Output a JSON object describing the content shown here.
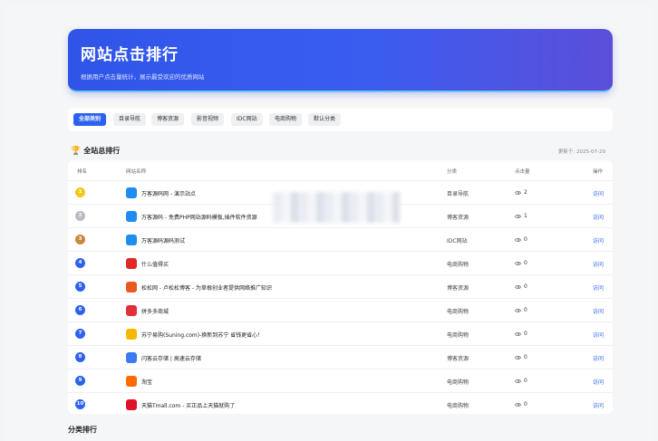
{
  "hero": {
    "title": "网站点击排行",
    "subtitle": "根据用户点击量统计，展示最受欢迎的优质网站"
  },
  "filters": [
    "全部类别",
    "目录导航",
    "博客资源",
    "影音视频",
    "IDC网站",
    "电商购物",
    "默认分类"
  ],
  "overall": {
    "title": "全站总排行",
    "updated": "更新于: 2025-07-29",
    "columns": [
      "排名",
      "网站名称",
      "分类",
      "点击量",
      "操作"
    ],
    "rows": [
      {
        "rank": "1",
        "name": "万客源码网 - 演示站点",
        "category": "目录导航",
        "clicks": "2",
        "action": "访问"
      },
      {
        "rank": "2",
        "name": "万客源码 - 免费PHP网站源码模板,插件软件资源",
        "category": "博客资源",
        "clicks": "1",
        "action": "访问"
      },
      {
        "rank": "3",
        "name": "万客源码源码测试",
        "category": "IDC网站",
        "clicks": "0",
        "action": "访问"
      },
      {
        "rank": "4",
        "name": "什么值得买",
        "category": "电商购物",
        "clicks": "0",
        "action": "访问"
      },
      {
        "rank": "5",
        "name": "松松网 - 卢松松博客 - 为草根创业者提供网络推广知识",
        "category": "博客资源",
        "clicks": "0",
        "action": "访问"
      },
      {
        "rank": "6",
        "name": "拼多多商城",
        "category": "电商购物",
        "clicks": "0",
        "action": "访问"
      },
      {
        "rank": "7",
        "name": "苏宁易购(Suning.com)-换新到苏宁 省钱更省心！",
        "category": "电商购物",
        "clicks": "0",
        "action": "访问"
      },
      {
        "rank": "8",
        "name": "闪客云存储 | 高速云存储",
        "category": "博客资源",
        "clicks": "0",
        "action": "访问"
      },
      {
        "rank": "9",
        "name": "淘宝",
        "category": "电商购物",
        "clicks": "0",
        "action": "访问"
      },
      {
        "rank": "10",
        "name": "天猫Tmall.com - 买正品上天猫就购了",
        "category": "电商购物",
        "clicks": "0",
        "action": "访问"
      }
    ]
  },
  "category_rank_title": "分类排行",
  "colors": {
    "accent": "#2d62f0",
    "rank_gold": "#f5c518",
    "rank_silver": "#b9bcc2",
    "rank_bronze": "#c8893e",
    "rank_other": "#2d62f0"
  }
}
